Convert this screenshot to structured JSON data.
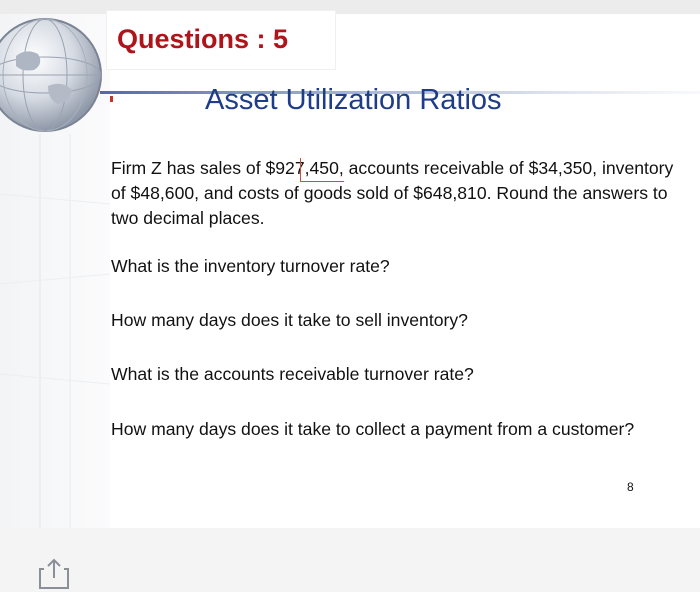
{
  "slide": {
    "title": "Questions : 5",
    "subtitle": "Asset Utilization Ratios",
    "paragraph": "Firm Z has sales of $927,450, accounts receivable of $34,350, inventory of $48,600, and costs of goods sold of $648,810. Round the answers to two decimal places.",
    "questions": [
      "What is the inventory turnover rate?",
      "How many days does it take to sell inventory?",
      "What is the accounts receivable turnover rate?",
      "How many days does it take to collect a payment from a customer?"
    ],
    "page_number": "8"
  },
  "toolbar": {
    "share_icon": "share-icon"
  },
  "colors": {
    "title": "#b0141b",
    "subtitle": "#1f3c88",
    "header_bar_blue": "#3b5aa0",
    "accent_red": "#d14b3c"
  }
}
